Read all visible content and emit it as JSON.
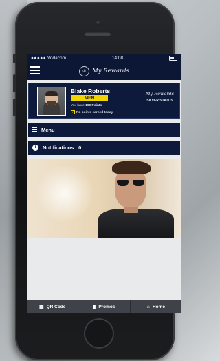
{
  "status_bar": {
    "signal": "●●●●●",
    "carrier": "Vodacom",
    "time": "14:08"
  },
  "header": {
    "logo_badge": "♔",
    "title": "My Rewards"
  },
  "profile": {
    "name": "Blake Roberts",
    "category": "MEN",
    "points_prefix": "You have",
    "points_value": "100 Points",
    "today_note": "No points earned today",
    "brand": "My Rewards",
    "status": "SILVER STATUS"
  },
  "menu": {
    "label": "Menu"
  },
  "notifications": {
    "icon_glyph": "i",
    "label": "Notifications : 0"
  },
  "tabs": [
    {
      "label": "QR Code",
      "icon": "qr-code-icon",
      "glyph": "▦"
    },
    {
      "label": "Promos",
      "icon": "promo-bag-icon",
      "glyph": "▮"
    },
    {
      "label": "Home",
      "icon": "home-icon",
      "glyph": "⌂"
    }
  ],
  "colors": {
    "navy": "#0b1735",
    "accent_yellow": "#f2d400",
    "tabbar": "#3f4349"
  }
}
